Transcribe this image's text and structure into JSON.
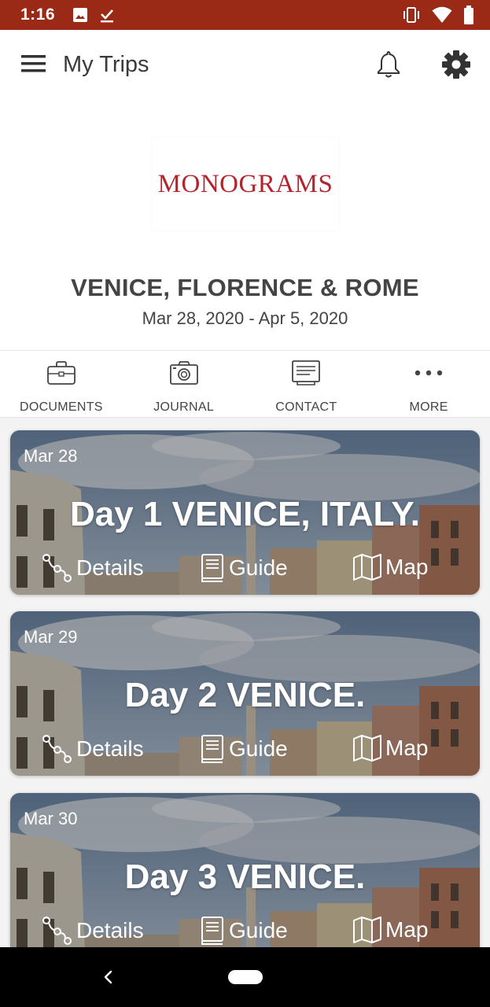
{
  "status_bar": {
    "time": "1:16",
    "left_icons": [
      "image-icon",
      "download-done-icon"
    ],
    "right_icons": [
      "vibrate-icon",
      "wifi-icon",
      "battery-icon"
    ],
    "background": "#9a2a15"
  },
  "app_bar": {
    "title": "My Trips",
    "menu_icon": "menu-icon",
    "bell_icon": "bell-icon",
    "settings_icon": "gear-icon"
  },
  "logo": {
    "brand": "MONOGRAMS",
    "color": "#b5232c"
  },
  "trip": {
    "title": "VENICE, FLORENCE & ROME",
    "dates": "Mar 28, 2020 - Apr 5, 2020"
  },
  "actions": [
    {
      "label": "DOCUMENTS",
      "icon": "briefcase-icon"
    },
    {
      "label": "JOURNAL",
      "icon": "camera-icon"
    },
    {
      "label": "CONTACT",
      "icon": "contact-card-icon"
    },
    {
      "label": "MORE",
      "icon": "more-icon"
    }
  ],
  "days": [
    {
      "date": "Mar 28",
      "title": "Day 1 VENICE, ITALY.",
      "links": {
        "details": "Details",
        "guide": "Guide",
        "map": "Map"
      }
    },
    {
      "date": "Mar 29",
      "title": "Day 2 VENICE.",
      "links": {
        "details": "Details",
        "guide": "Guide",
        "map": "Map"
      }
    },
    {
      "date": "Mar 30",
      "title": "Day 3 VENICE.",
      "links": {
        "details": "Details",
        "guide": "Guide",
        "map": "Map"
      }
    }
  ],
  "nav_bar": {
    "back_icon": "back-icon",
    "home_icon": "home-pill-icon"
  }
}
